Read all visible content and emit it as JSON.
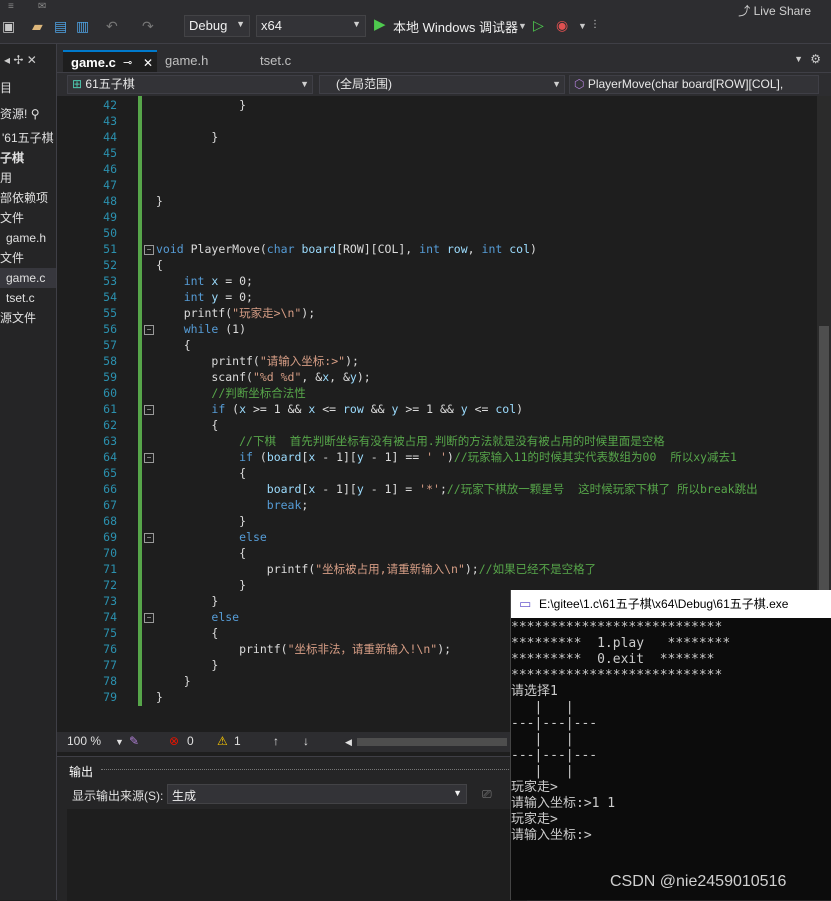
{
  "toolbar": {
    "config": "Debug",
    "platform": "x64",
    "run_label": "本地 Windows 调试器",
    "live_share": "Live Share"
  },
  "sidebar": {
    "items": [
      {
        "label": "目"
      },
      {
        "label": "资源!"
      },
      {
        "label": "'61五子棋"
      },
      {
        "label": "子棋"
      },
      {
        "label": "用"
      },
      {
        "label": "部依赖项"
      },
      {
        "label": "文件"
      },
      {
        "label": "game.h"
      },
      {
        "label": "文件"
      },
      {
        "label": "game.c"
      },
      {
        "label": "tset.c"
      },
      {
        "label": "源文件"
      }
    ]
  },
  "tabs": [
    {
      "label": "game.c"
    },
    {
      "label": "game.h"
    },
    {
      "label": "tset.c"
    }
  ],
  "nav": {
    "project": "61五子棋",
    "scope": "(全局范围)",
    "member": "PlayerMove(char board[ROW][COL],"
  },
  "editor": {
    "lines": [
      {
        "n": "42",
        "html": "            }"
      },
      {
        "n": "43",
        "html": ""
      },
      {
        "n": "44",
        "html": "        }"
      },
      {
        "n": "45",
        "html": ""
      },
      {
        "n": "46",
        "html": ""
      },
      {
        "n": "47",
        "html": ""
      },
      {
        "n": "48",
        "html": "}"
      },
      {
        "n": "49",
        "html": ""
      },
      {
        "n": "50",
        "html": ""
      },
      {
        "n": "51",
        "html": "void PlayerMove(char board[ROW][COL], int row, int col)"
      },
      {
        "n": "52",
        "html": "{"
      },
      {
        "n": "53",
        "html": "    int x = 0;"
      },
      {
        "n": "54",
        "html": "    int y = 0;"
      },
      {
        "n": "55",
        "html": "    printf(\"玩家走>\\n\");"
      },
      {
        "n": "56",
        "html": "    while (1)"
      },
      {
        "n": "57",
        "html": "    {"
      },
      {
        "n": "58",
        "html": "        printf(\"请输入坐标:>\");"
      },
      {
        "n": "59",
        "html": "        scanf(\"%d %d\", &x, &y);"
      },
      {
        "n": "60",
        "html": "        //判断坐标合法性"
      },
      {
        "n": "61",
        "html": "        if (x >= 1 && x <= row && y >= 1 && y <= col)"
      },
      {
        "n": "62",
        "html": "        {"
      },
      {
        "n": "63",
        "html": "            //下棋  首先判断坐标有没有被占用.判断的方法就是没有被占用的时候里面是空格"
      },
      {
        "n": "64",
        "html": "            if (board[x - 1][y - 1] == ' ')//玩家输入11的时候其实代表数组为00  所以xy减去1"
      },
      {
        "n": "65",
        "html": "            {"
      },
      {
        "n": "66",
        "html": "                board[x - 1][y - 1] = '*';//玩家下棋放一颗星号  这时候玩家下棋了 所以break跳出"
      },
      {
        "n": "67",
        "html": "                break;"
      },
      {
        "n": "68",
        "html": "            }"
      },
      {
        "n": "69",
        "html": "            else"
      },
      {
        "n": "70",
        "html": "            {"
      },
      {
        "n": "71",
        "html": "                printf(\"坐标被占用,请重新输入\\n\");//如果已经不是空格了"
      },
      {
        "n": "72",
        "html": "            }"
      },
      {
        "n": "73",
        "html": "        }"
      },
      {
        "n": "74",
        "html": "        else"
      },
      {
        "n": "75",
        "html": "        {"
      },
      {
        "n": "76",
        "html": "            printf(\"坐标非法，请重新输入!\\n\");"
      },
      {
        "n": "77",
        "html": "        }"
      },
      {
        "n": "78",
        "html": "    }"
      },
      {
        "n": "79",
        "html": "}"
      }
    ]
  },
  "status": {
    "zoom": "100 %",
    "errors": "0",
    "warnings": "1"
  },
  "output": {
    "title": "输出",
    "source_label": "显示输出来源(S):",
    "source_value": "生成"
  },
  "console": {
    "title": "E:\\gitee\\1.c\\61五子棋\\x64\\Debug\\61五子棋.exe",
    "lines": [
      "***************************",
      "*********  1.play   ********",
      "*********  0.exit  *******",
      "***************************",
      "请选择1",
      "   |   |   ",
      "---|---|---",
      "   |   |   ",
      "---|---|---",
      "   |   |   ",
      "玩家走>",
      "请输入坐标:>1 1",
      "玩家走>",
      "请输入坐标:>"
    ]
  },
  "watermark": "CSDN @nie2459010516",
  "colors": {
    "accent": "#007acc",
    "keyword": "#569cd6",
    "comment": "#57a64a",
    "string": "#d69d85",
    "line_number": "#2b91af"
  }
}
